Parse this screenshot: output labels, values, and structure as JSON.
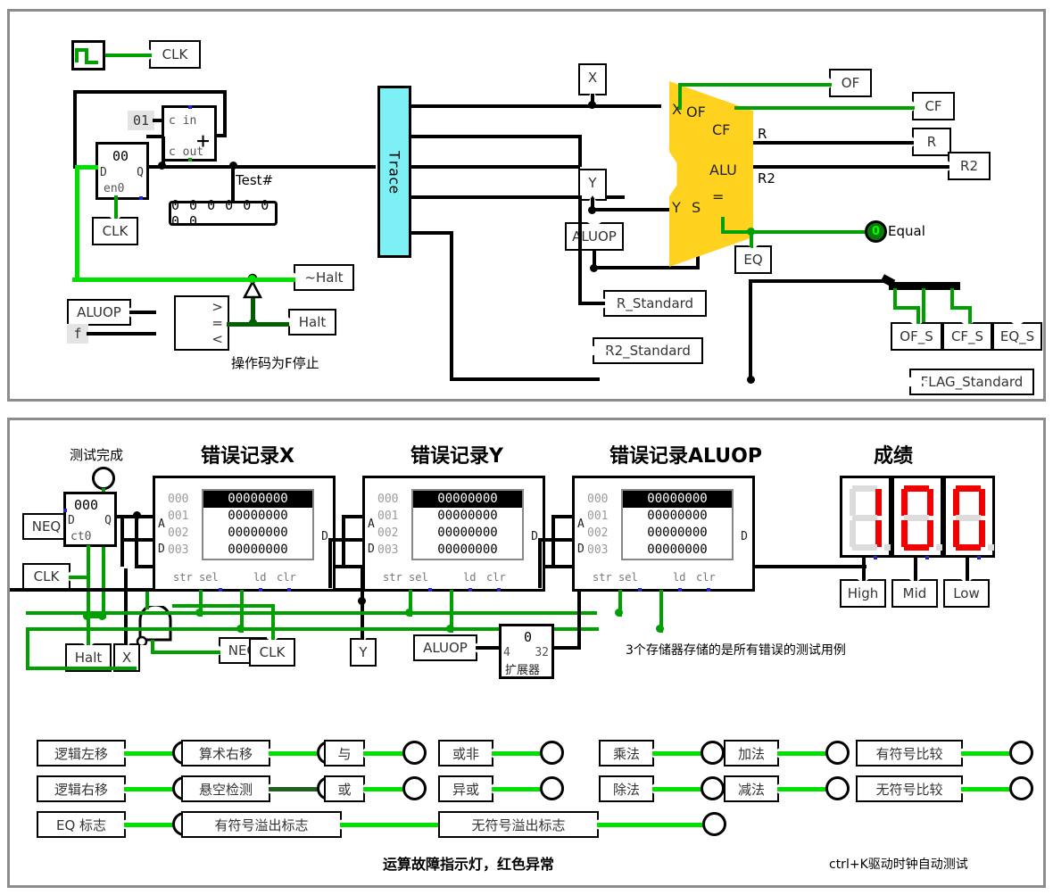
{
  "top_panel": {
    "clock_source_label": "CLK",
    "clock_tag": "CLK",
    "const_01": "01",
    "adder": {
      "c_in": "c in",
      "c_out": "c out",
      "symbol": "+"
    },
    "register": {
      "value": "00",
      "d": "D",
      "q": "Q",
      "en": "en0"
    },
    "register_clk_tag": "CLK",
    "testnum_label": "Test#",
    "testnum_value": "0 0 0 0 0 0 0 0",
    "trace_label": "Trace",
    "x_probe": "X",
    "y_probe": "Y",
    "aluop_probe": "ALUOP",
    "alu": {
      "name": "ALU",
      "in_x": "X",
      "in_y": "Y",
      "in_s": "S",
      "out_of": "OF",
      "out_cf": "CF",
      "out_eq": "=",
      "out_r": "R",
      "out_r2": "R2"
    },
    "out_of": "OF",
    "out_cf": "CF",
    "out_r": "R",
    "out_r2": "R2",
    "eq_probe": "EQ",
    "equal_led_value": "0",
    "equal_label": "Equal",
    "r_standard": "R_Standard",
    "r2_standard": "R2_Standard",
    "flag_standard": "FLAG_Standard",
    "flag_bits": [
      "OF_S",
      "CF_S",
      "EQ_S"
    ],
    "halt_in_aluop": "ALUOP",
    "halt_const_f": "f",
    "comparator": {
      "gt": ">",
      "eq": "=",
      "lt": "<"
    },
    "not_halt": "~Halt",
    "halt": "Halt",
    "note": "操作码为F停止"
  },
  "bottom_panel": {
    "test_done_label": "测试完成",
    "neq_in": "NEQ",
    "clk_in": "CLK",
    "counter": {
      "value": "000",
      "d": "D",
      "q": "Q",
      "en": "ct0"
    },
    "halt_probe": "Halt",
    "x_probe": "X",
    "y_probe": "Y",
    "neq_probe": "NEQ",
    "clk_probe": "CLK",
    "nand_out": "NEQ",
    "aluop_tag": "ALUOP",
    "extender": {
      "top": "0",
      "in": "4",
      "out": "32",
      "name": "扩展器"
    },
    "memo_note": "3个存储器存储的是所有错误的测试用例",
    "memories": [
      {
        "title": "错误记录X",
        "addrs": [
          "000",
          "001",
          "002",
          "003"
        ],
        "values": [
          "00000000",
          "00000000",
          "00000000",
          "00000000"
        ],
        "selected": 0,
        "pins_left": [
          "A",
          "D"
        ],
        "pin_right": "D",
        "pins_bottom": [
          "str",
          "sel",
          "ld",
          "clr"
        ]
      },
      {
        "title": "错误记录Y",
        "addrs": [
          "000",
          "001",
          "002",
          "003"
        ],
        "values": [
          "00000000",
          "00000000",
          "00000000",
          "00000000"
        ],
        "selected": 0,
        "pins_left": [
          "A",
          "D"
        ],
        "pin_right": "D",
        "pins_bottom": [
          "str",
          "sel",
          "ld",
          "clr"
        ]
      },
      {
        "title": "错误记录ALUOP",
        "addrs": [
          "000",
          "001",
          "002",
          "003"
        ],
        "values": [
          "00000000",
          "00000000",
          "00000000",
          "00000000"
        ],
        "selected": 0,
        "pins_left": [
          "A",
          "D"
        ],
        "pin_right": "D",
        "pins_bottom": [
          "str",
          "sel",
          "ld",
          "clr"
        ]
      }
    ],
    "score": {
      "title": "成绩",
      "digits": [
        "1",
        "0",
        "0"
      ],
      "labels": [
        "High",
        "Mid",
        "Low"
      ],
      "color": "#f50000"
    },
    "indicators": [
      {
        "label": "逻辑左移",
        "col": 0,
        "row": 0
      },
      {
        "label": "逻辑右移",
        "col": 0,
        "row": 1
      },
      {
        "label": "EQ 标志",
        "col": 0,
        "row": 2
      },
      {
        "label": "算术右移",
        "col": 1,
        "row": 0
      },
      {
        "label": "悬空检测",
        "col": 1,
        "row": 1
      },
      {
        "label": "有符号溢出标志",
        "col": 1,
        "row": 2
      },
      {
        "label": "与",
        "col": 2,
        "row": 0
      },
      {
        "label": "或",
        "col": 2,
        "row": 1
      },
      {
        "label": "或非",
        "col": 3,
        "row": 0
      },
      {
        "label": "异或",
        "col": 3,
        "row": 1
      },
      {
        "label": "无符号溢出标志",
        "col": 3,
        "row": 2
      },
      {
        "label": "乘法",
        "col": 4,
        "row": 0
      },
      {
        "label": "除法",
        "col": 4,
        "row": 1
      },
      {
        "label": "加法",
        "col": 5,
        "row": 0
      },
      {
        "label": "减法",
        "col": 5,
        "row": 1
      },
      {
        "label": "有符号比较",
        "col": 6,
        "row": 0
      },
      {
        "label": "无符号比较",
        "col": 6,
        "row": 1
      }
    ],
    "footer_left": "运算故障指示灯，红色异常",
    "footer_right": "ctrl+K驱动时钟自动测试"
  },
  "colors": {
    "wire_off": "#00a000",
    "wire_on": "#00e000",
    "bus": "#000000",
    "alu_fill": "#ffd21f",
    "trace_fill": "#7df0f5",
    "seg_on": "#f50000",
    "seg_off": "#dcdcdc"
  }
}
